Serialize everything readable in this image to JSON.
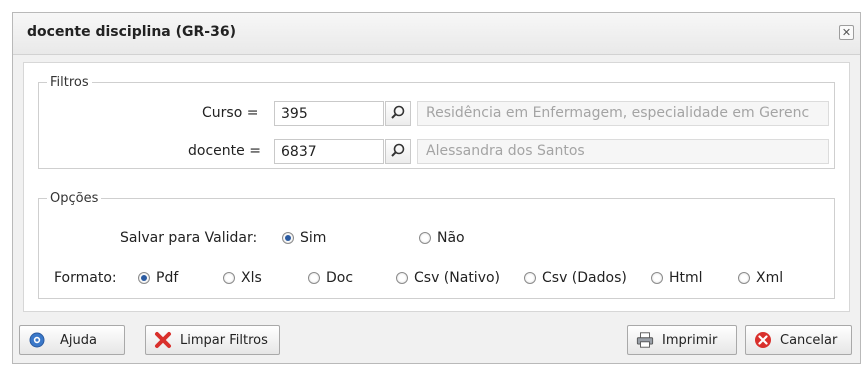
{
  "dialog": {
    "title": "docente disciplina (GR-36)",
    "close_label": "✕"
  },
  "filters": {
    "legend": "Filtros",
    "curso": {
      "label": "Curso =",
      "value": "395",
      "description": "Residência em Enfermagem, especialidade em Gerenc"
    },
    "docente": {
      "label": "docente =",
      "value": "6837",
      "description": "Alessandra dos Santos"
    }
  },
  "options": {
    "legend": "Opções",
    "salvar": {
      "label": "Salvar para Validar:",
      "choices": [
        "Sim",
        "Não"
      ],
      "selected": "Sim"
    },
    "formato": {
      "label": "Formato:",
      "choices": [
        "Pdf",
        "Xls",
        "Doc",
        "Csv (Nativo)",
        "Csv (Dados)",
        "Html",
        "Xml"
      ],
      "selected": "Pdf"
    }
  },
  "buttons": {
    "help": "Ajuda",
    "clear": "Limpar Filtros",
    "print": "Imprimir",
    "cancel": "Cancelar"
  },
  "colors": {
    "radio_selected": "#2a5aa0",
    "cancel_icon": "#d9302c",
    "clear_icon": "#d9302c",
    "help_icon": "#3a78c9"
  },
  "icons": {
    "lookup": "magnifier-icon",
    "help": "question-icon",
    "clear": "red-x-icon",
    "print": "printer-icon",
    "cancel": "cancel-icon"
  }
}
